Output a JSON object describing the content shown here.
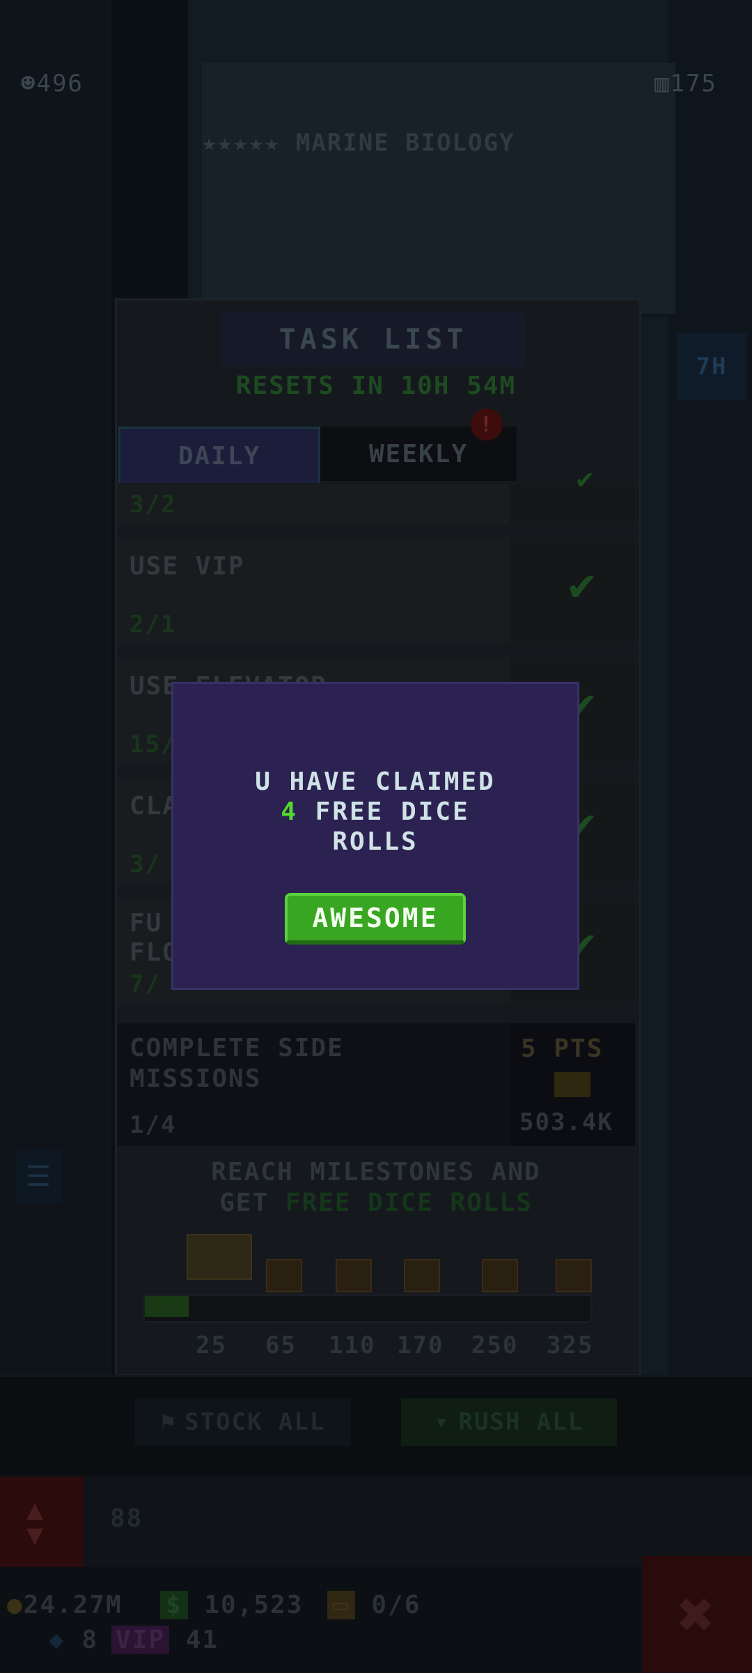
{
  "top": {
    "left_count": "496",
    "right_count": "175",
    "floor_name": "MARINE BIOLOGY",
    "floor_stars": "★★★★★"
  },
  "side_timer": "7H",
  "task_list": {
    "title": "TASK LIST",
    "resets": "RESETS IN 10H 54M",
    "tabs": [
      {
        "label": "DAILY",
        "active": true
      },
      {
        "label": "WEEKLY",
        "active": false,
        "badge": "!"
      }
    ],
    "tasks": [
      {
        "label": "",
        "progress": "3/2",
        "completed": true
      },
      {
        "label": "USE VIP",
        "progress": "2/1",
        "completed": true
      },
      {
        "label": "USE ELEVATOR",
        "progress": "15/",
        "completed": true
      },
      {
        "label": "CLA",
        "progress": "3/",
        "completed": true
      },
      {
        "label": "FU\nFLO",
        "progress": "7/",
        "completed": true
      }
    ],
    "side_mission": {
      "label_line1": "COMPLETE SIDE",
      "label_line2": "MISSIONS",
      "progress": "1/4",
      "points": "5 PTS",
      "reward": "503.4K"
    },
    "milestones": {
      "text_line1": "REACH MILESTONES AND",
      "text_line2_prefix": "GET ",
      "text_line2_highlight": "FREE DICE ROLLS",
      "values": [
        "25",
        "65",
        "110",
        "170",
        "250",
        "325"
      ],
      "progress_fraction": 0.1
    }
  },
  "bottom_buttons": {
    "stock_all": "STOCK ALL",
    "rush_all": "RUSH ALL"
  },
  "floor_number": "88",
  "currency": {
    "coins": "24.27M",
    "bux": "10,523",
    "tickets": "0/6",
    "gems": "8",
    "vip": "41"
  },
  "modal": {
    "line1": "U HAVE CLAIMED",
    "count": "4",
    "line2_suffix": "FREE DICE",
    "line3": "ROLLS",
    "button": "AWESOME"
  },
  "colors": {
    "modal_bg": "#2c2252",
    "button_green": "#39a622",
    "highlight_green": "#54d92c"
  }
}
